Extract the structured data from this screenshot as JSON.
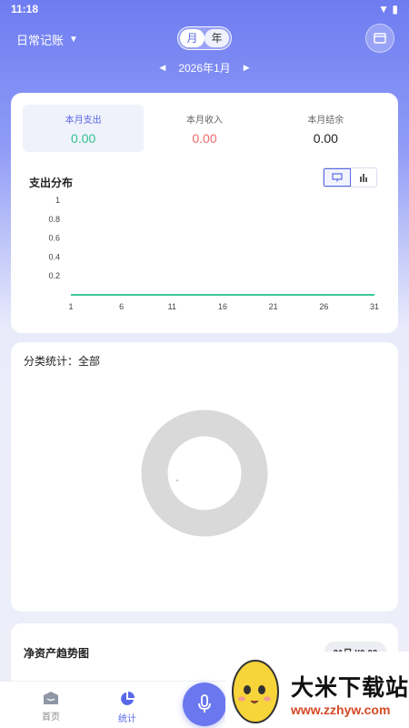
{
  "status_bar": {
    "time": "11:18",
    "icons": [
      "wifi-icon",
      "battery-icon"
    ]
  },
  "header": {
    "book_name": "日常记账",
    "period_options": [
      "月",
      "年"
    ],
    "selected_period": "月",
    "month_label": "2026年1月"
  },
  "summary": {
    "expense": {
      "label": "本月支出",
      "value": "0.00",
      "color": "#2ec48f"
    },
    "income": {
      "label": "本月收入",
      "value": "0.00",
      "color": "#ee6b6b"
    },
    "balance": {
      "label": "本月结余",
      "value": "0.00",
      "color": "#222222"
    }
  },
  "expense_distribution": {
    "title": "支出分布"
  },
  "chart_data": [
    {
      "type": "line",
      "title": "支出分布",
      "x": [
        1,
        6,
        11,
        16,
        21,
        26,
        31
      ],
      "ytick_labels": [
        "0.2",
        "0.4",
        "0.6",
        "0.8",
        "1"
      ],
      "series": [
        {
          "values": [
            0,
            0,
            0,
            0,
            0,
            0,
            0
          ],
          "color": "#3ec79a"
        }
      ],
      "xlim": [
        1,
        31
      ],
      "ylim": [
        0,
        1
      ],
      "grid": false
    }
  ],
  "category": {
    "title": "分类统计：全部"
  },
  "trend": {
    "title": "净资产趋势图",
    "badge": "31日 ¥0.00"
  },
  "bottom_nav": {
    "home": "首页",
    "stats": "统计"
  },
  "watermark": {
    "name": "大米下载站",
    "url": "www.zzhyw.com"
  },
  "colors": {
    "accent": "#5868e8",
    "expense": "#2ec48f",
    "income": "#ee6b6b"
  }
}
